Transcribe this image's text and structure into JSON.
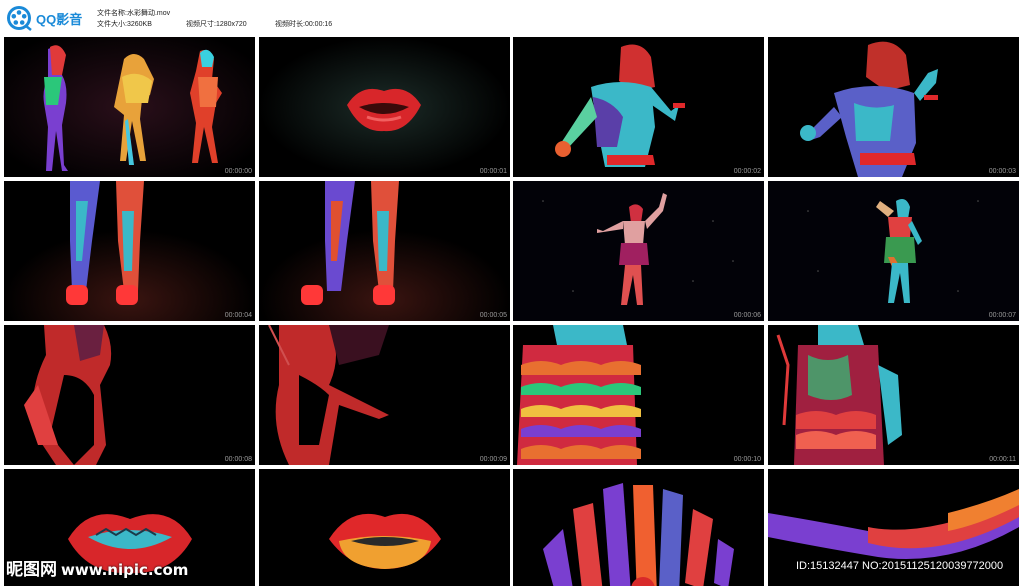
{
  "app": {
    "logo_text": "QQ影音",
    "logo_icon": "film-reel-icon",
    "accent_color": "#1a8ad8"
  },
  "file_info": {
    "name_key": "文件名称:",
    "name_value": "水彩舞动.mov",
    "size_key": "文件大小:",
    "size_value": "3260KB",
    "dim_key": "视频尺寸:",
    "dim_value": "1280x720",
    "duration_key": "视频时长:",
    "duration_value": "00:00:16"
  },
  "thumbnails": [
    {
      "time": "00:00:00",
      "scene": "three-dancers"
    },
    {
      "time": "00:00:01",
      "scene": "lips-glow"
    },
    {
      "time": "00:00:02",
      "scene": "dancer-back"
    },
    {
      "time": "00:00:03",
      "scene": "dancer-back-2"
    },
    {
      "time": "00:00:04",
      "scene": "legs"
    },
    {
      "time": "00:00:05",
      "scene": "legs-2"
    },
    {
      "time": "00:00:06",
      "scene": "dancer-full"
    },
    {
      "time": "00:00:07",
      "scene": "dancer-full-2"
    },
    {
      "time": "00:00:08",
      "scene": "hair-closeup"
    },
    {
      "time": "00:00:09",
      "scene": "hair-closeup-2"
    },
    {
      "time": "00:00:10",
      "scene": "skirt-ruffles"
    },
    {
      "time": "00:00:11",
      "scene": "skirt-ruffles-2"
    },
    {
      "time": "",
      "scene": "lips-teeth"
    },
    {
      "time": "",
      "scene": "lips-yellow"
    },
    {
      "time": "",
      "scene": "abstract-stripes"
    },
    {
      "time": "",
      "scene": "ribbon"
    }
  ],
  "watermark": {
    "site_cn": "昵图网",
    "site_url": "www.nipic.com",
    "id_text": "ID:15132447 NO:20151125120039772000"
  }
}
